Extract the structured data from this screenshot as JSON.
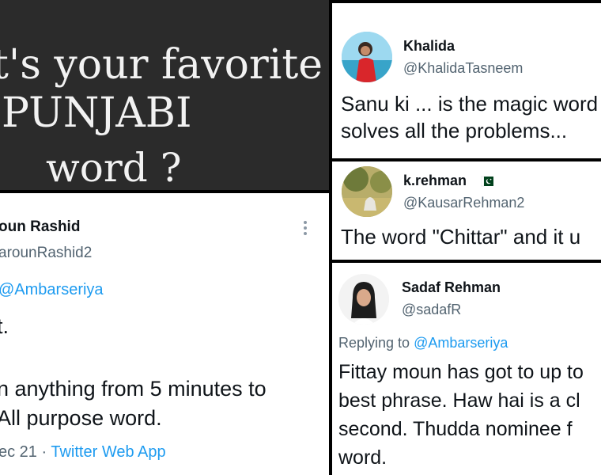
{
  "title_card": {
    "line1": "t's your favorite",
    "line2": "PUNJABI",
    "line3": "word ?"
  },
  "tweet_haroun": {
    "name": "oun Rashid",
    "handle": "arounRashid2",
    "reply_mention": "@Ambarseriya",
    "text_line1": "t.",
    "text_line2": "n anything from 5 minutes to",
    "text_line3": "All purpose word.",
    "date": "ec 21",
    "separator": "·",
    "source": "Twitter Web App"
  },
  "tweet_khalida": {
    "name": "Khalida",
    "handle": "@KhalidaTasneem",
    "text_line1": "Sanu ki ... is the magic word",
    "text_line2": "solves all the problems..."
  },
  "tweet_kausar": {
    "name": "k.rehman",
    "handle": "@KausarRehman2",
    "text_line1": "The word \"Chittar\" and it u"
  },
  "tweet_sadaf": {
    "name": "Sadaf Rehman",
    "handle": "@sadafR",
    "replying_label": "Replying to",
    "reply_mention": "@Ambarseriya",
    "text_line1": "Fittay moun has got to up to",
    "text_line2": "best phrase. Haw hai is a cl",
    "text_line3": "second.  Thudda nominee f",
    "text_line4": "word."
  },
  "colors": {
    "link": "#1d9bf0",
    "muted": "#536471",
    "text": "#0f1419",
    "title_bg": "#2b2b2b",
    "flag_green": "#01411c"
  },
  "icons": [
    "more-vertical-icon",
    "pakistan-flag-icon"
  ]
}
